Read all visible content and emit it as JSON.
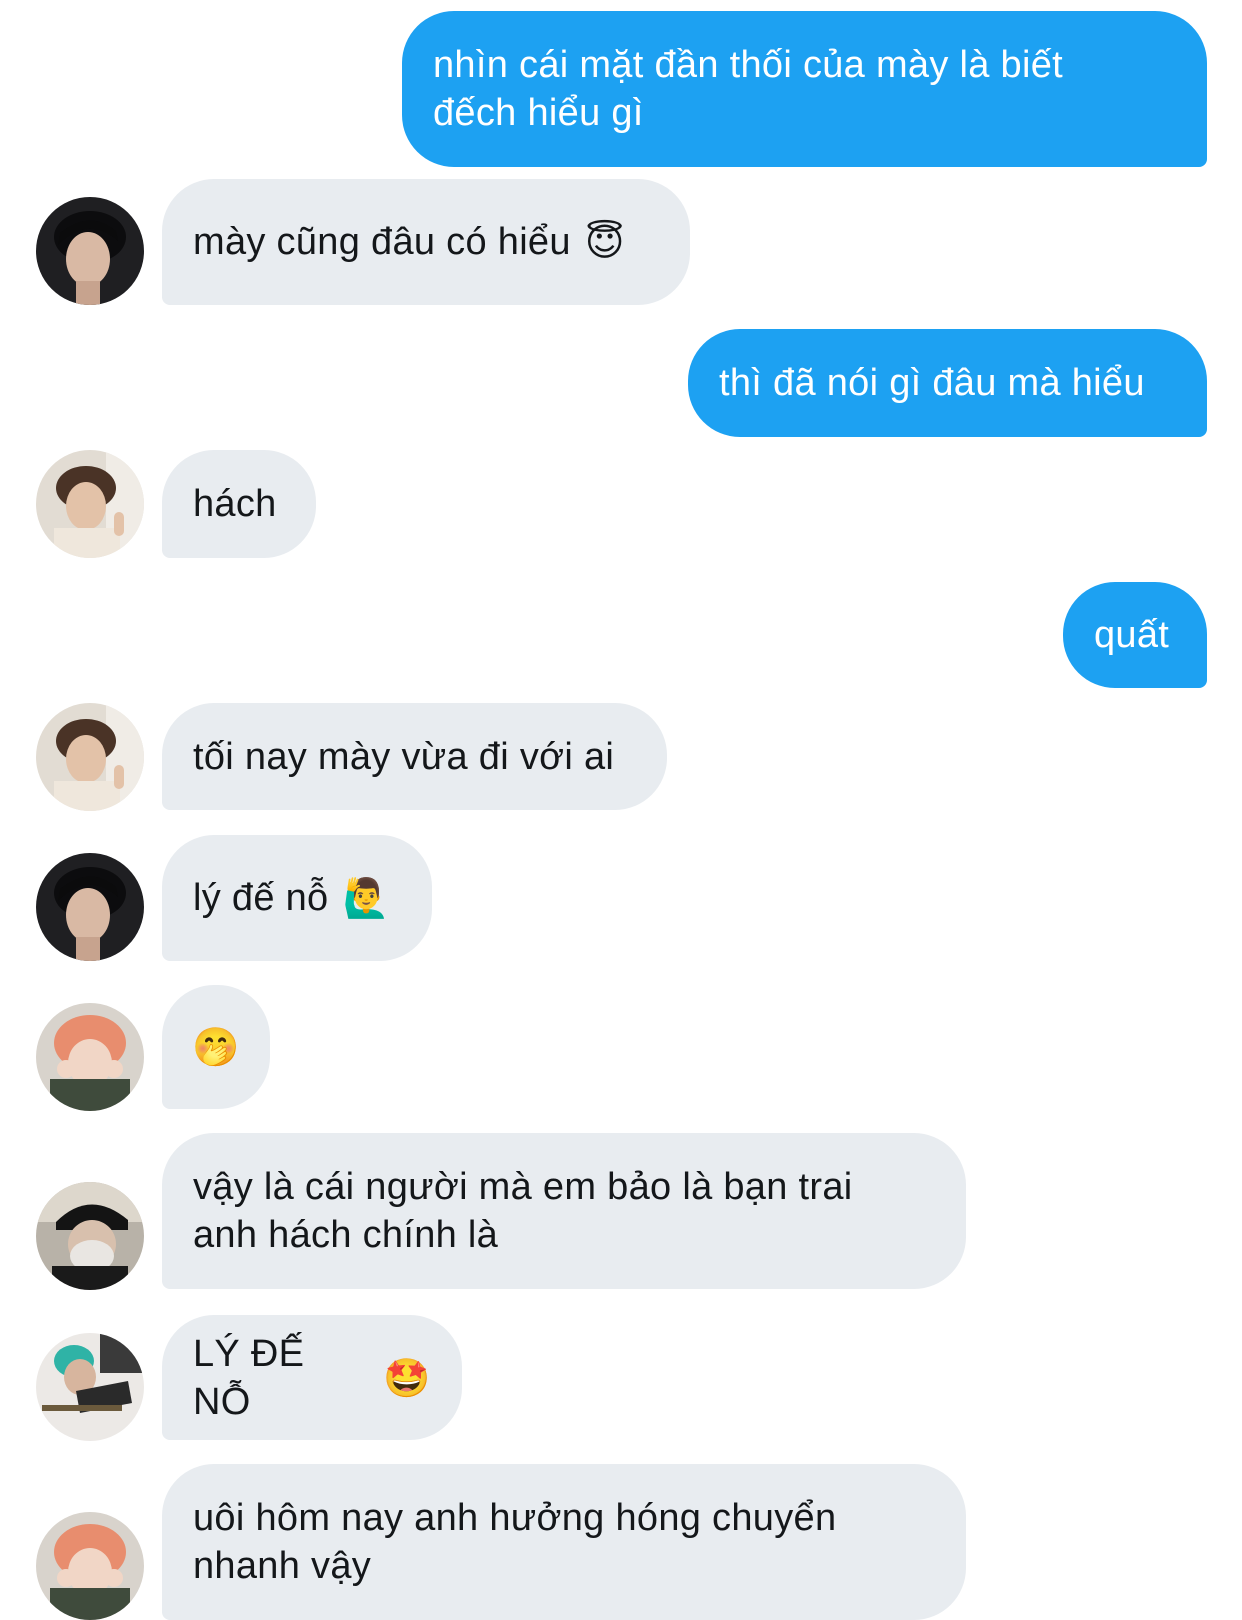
{
  "messages": [
    {
      "direction": "outgoing",
      "text": "nhìn cái mặt đần thối của mày là biết\nđếch hiểu gì"
    },
    {
      "direction": "incoming",
      "avatar": "avatar-1-dark-hair",
      "text": "mày cũng đâu có hiểu",
      "emoji": "😇",
      "emoji_name": "smiling-face-with-halo-emoji"
    },
    {
      "direction": "outgoing",
      "text": "thì đã nói gì đâu mà hiểu"
    },
    {
      "direction": "incoming",
      "avatar": "avatar-2-peace-sign",
      "text": "hách"
    },
    {
      "direction": "outgoing",
      "text": "quất"
    },
    {
      "direction": "incoming",
      "avatar": "avatar-2-peace-sign",
      "text": "tối nay mày vừa đi với ai"
    },
    {
      "direction": "incoming",
      "avatar": "avatar-1-dark-hair",
      "text": "lý đế nỗ",
      "emoji": "🙋‍♂️",
      "emoji_name": "man-raising-hand-emoji"
    },
    {
      "direction": "incoming",
      "avatar": "avatar-3-orange-hair",
      "text": "",
      "emoji": "🤭",
      "emoji_name": "face-with-hand-over-mouth-emoji"
    },
    {
      "direction": "incoming",
      "avatar": "avatar-4-cap-mask",
      "text": "vậy là cái người mà em bảo là bạn trai\nanh hách chính là"
    },
    {
      "direction": "incoming",
      "avatar": "avatar-5-guitar",
      "text": "LÝ ĐẾ NỖ",
      "emoji": "🤩",
      "emoji_name": "star-struck-emoji"
    },
    {
      "direction": "incoming",
      "avatar": "avatar-3-orange-hair",
      "text": "uôi hôm nay anh hưởng hóng chuyển\nnhanh vậy"
    }
  ],
  "colors": {
    "outgoing_bubble": "#1da1f2",
    "incoming_bubble": "#e8ecf0",
    "incoming_text": "#14171a",
    "outgoing_text": "#ffffff"
  }
}
